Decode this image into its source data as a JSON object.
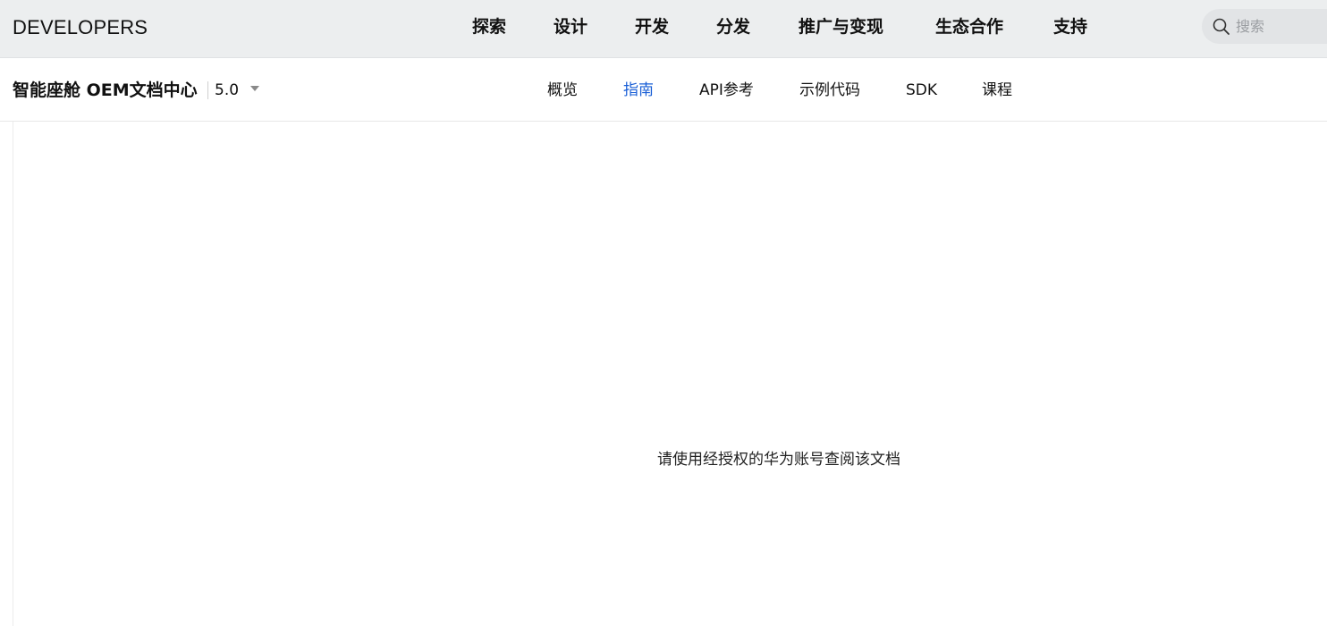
{
  "topbar": {
    "brand": "DEVELOPERS",
    "nav": [
      "探索",
      "设计",
      "开发",
      "分发",
      "推广与变现",
      "生态合作",
      "支持"
    ],
    "search_placeholder": "搜索"
  },
  "subbar": {
    "doc_title": "智能座舱 OEM文档中心",
    "version": "5.0",
    "tabs": [
      "概览",
      "指南",
      "API参考",
      "示例代码",
      "SDK",
      "课程"
    ],
    "active_tab": "指南",
    "active_color": "#1a5fd6"
  },
  "content": {
    "notice": "请使用经授权的华为账号查阅该文档"
  }
}
